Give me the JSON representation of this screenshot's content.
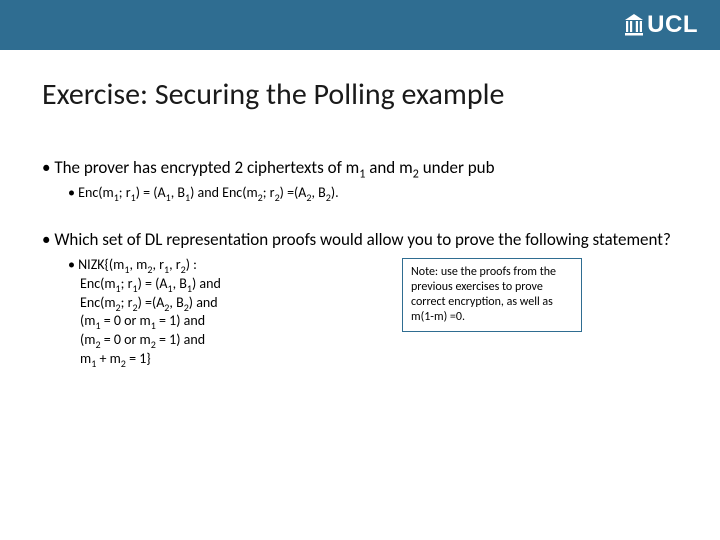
{
  "header": {
    "logo_text": "UCL"
  },
  "title": "Exercise: Securing the Polling example",
  "b1": "The prover has encrypted 2 ciphertexts of m",
  "b1_tail": " under pub",
  "b1_sub": "Enc(m",
  "b1_sub_mid1": ") = (A",
  "b1_sub_mid2": ") and Enc(m",
  "b1_sub_mid3": ") =(A",
  "b1_sub_end": ").",
  "b2": "Which set of DL representation proofs would allow you to prove the following statement?",
  "nizk": {
    "l1_a": "NIZK{(m",
    "l1_b": ", m",
    "l1_c": ", r",
    "l1_d": ", r",
    "l1_e": ") :",
    "l2_a": "Enc(m",
    "l2_b": "; r",
    "l2_c": ") = (A",
    "l2_d": ", B",
    "l2_e": ") and",
    "l3_a": "Enc(m",
    "l3_b": "; r",
    "l3_c": ") =(A",
    "l3_d": ", B",
    "l3_e": ") and",
    "l4_a": "(m",
    "l4_b": " = 0 or m",
    "l4_c": " = 1) and",
    "l5_a": "(m",
    "l5_b": " = 0 or m",
    "l5_c": " = 1) and",
    "l6_a": "m",
    "l6_b": " + m",
    "l6_c": " = 1}"
  },
  "note": "Note: use the proofs from the previous exercises to prove correct encryption, as well as m(1-m) =0.",
  "sub": {
    "one": "1",
    "two": "2"
  },
  "and_word": " and m",
  "semicolon_r": "; r",
  "comma_B": ", B"
}
